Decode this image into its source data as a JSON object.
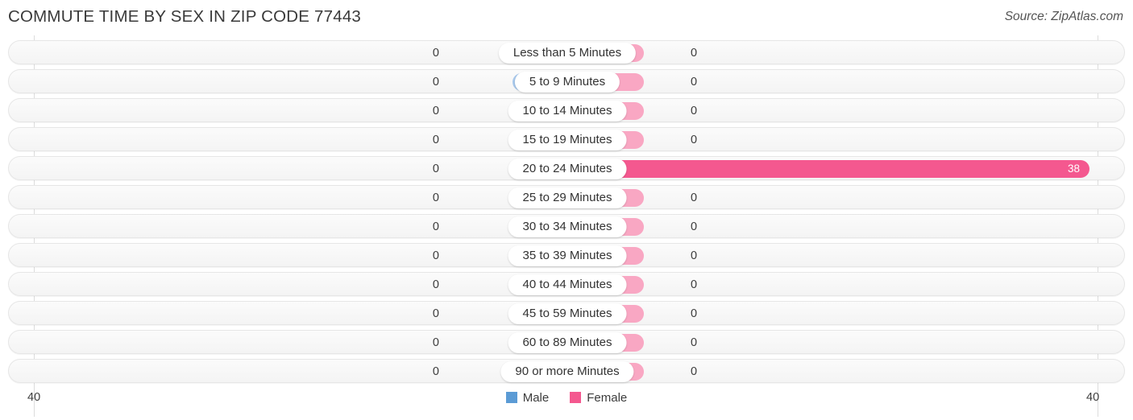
{
  "header": {
    "title": "COMMUTE TIME BY SEX IN ZIP CODE 77443",
    "source": "Source: ZipAtlas.com"
  },
  "legend": {
    "male_label": "Male",
    "female_label": "Female",
    "male_color": "#5b9bd5",
    "female_color": "#f4588f"
  },
  "axis": {
    "left_label": "40",
    "right_label": "40"
  },
  "colors": {
    "male_bar": "#a9c9ec",
    "female_bar": "#f9a7c3",
    "female_bar_highlight": "#f4588f",
    "row_track": "#f7f7f7"
  },
  "chart_data": {
    "type": "bar",
    "title": "COMMUTE TIME BY SEX IN ZIP CODE 77443",
    "subtitle": "Source: ZipAtlas.com",
    "orientation": "horizontal-diverging",
    "xlabel": "",
    "ylabel": "",
    "xlim": [
      40,
      40
    ],
    "axis_ticks": [
      "40",
      "40"
    ],
    "grid": true,
    "legend_position": "bottom-center",
    "categories": [
      "Less than 5 Minutes",
      "5 to 9 Minutes",
      "10 to 14 Minutes",
      "15 to 19 Minutes",
      "20 to 24 Minutes",
      "25 to 29 Minutes",
      "30 to 34 Minutes",
      "35 to 39 Minutes",
      "40 to 44 Minutes",
      "45 to 59 Minutes",
      "60 to 89 Minutes",
      "90 or more Minutes"
    ],
    "series": [
      {
        "name": "Male",
        "values": [
          0,
          0,
          0,
          0,
          0,
          0,
          0,
          0,
          0,
          0,
          0,
          0
        ]
      },
      {
        "name": "Female",
        "values": [
          0,
          0,
          0,
          0,
          38,
          0,
          0,
          0,
          0,
          0,
          0,
          0
        ]
      }
    ]
  },
  "rows": [
    {
      "label": "Less than 5 Minutes",
      "male": "0",
      "female": "0",
      "male_width": 68,
      "female_width": 95,
      "highlight": false,
      "show_female_inside": false
    },
    {
      "label": "5 to 9 Minutes",
      "male": "0",
      "female": "0",
      "male_width": 68,
      "female_width": 95,
      "highlight": false,
      "show_female_inside": false
    },
    {
      "label": "10 to 14 Minutes",
      "male": "0",
      "female": "0",
      "male_width": 68,
      "female_width": 95,
      "highlight": false,
      "show_female_inside": false
    },
    {
      "label": "15 to 19 Minutes",
      "male": "0",
      "female": "0",
      "male_width": 68,
      "female_width": 95,
      "highlight": false,
      "show_female_inside": false
    },
    {
      "label": "20 to 24 Minutes",
      "male": "0",
      "female": "38",
      "male_width": 68,
      "female_width": 648,
      "highlight": true,
      "show_female_inside": true
    },
    {
      "label": "25 to 29 Minutes",
      "male": "0",
      "female": "0",
      "male_width": 68,
      "female_width": 95,
      "highlight": false,
      "show_female_inside": false
    },
    {
      "label": "30 to 34 Minutes",
      "male": "0",
      "female": "0",
      "male_width": 68,
      "female_width": 95,
      "highlight": false,
      "show_female_inside": false
    },
    {
      "label": "35 to 39 Minutes",
      "male": "0",
      "female": "0",
      "male_width": 68,
      "female_width": 95,
      "highlight": false,
      "show_female_inside": false
    },
    {
      "label": "40 to 44 Minutes",
      "male": "0",
      "female": "0",
      "male_width": 68,
      "female_width": 95,
      "highlight": false,
      "show_female_inside": false
    },
    {
      "label": "45 to 59 Minutes",
      "male": "0",
      "female": "0",
      "male_width": 68,
      "female_width": 95,
      "highlight": false,
      "show_female_inside": false
    },
    {
      "label": "60 to 89 Minutes",
      "male": "0",
      "female": "0",
      "male_width": 68,
      "female_width": 95,
      "highlight": false,
      "show_female_inside": false
    },
    {
      "label": "90 or more Minutes",
      "male": "0",
      "female": "0",
      "male_width": 68,
      "female_width": 95,
      "highlight": false,
      "show_female_inside": false
    }
  ]
}
